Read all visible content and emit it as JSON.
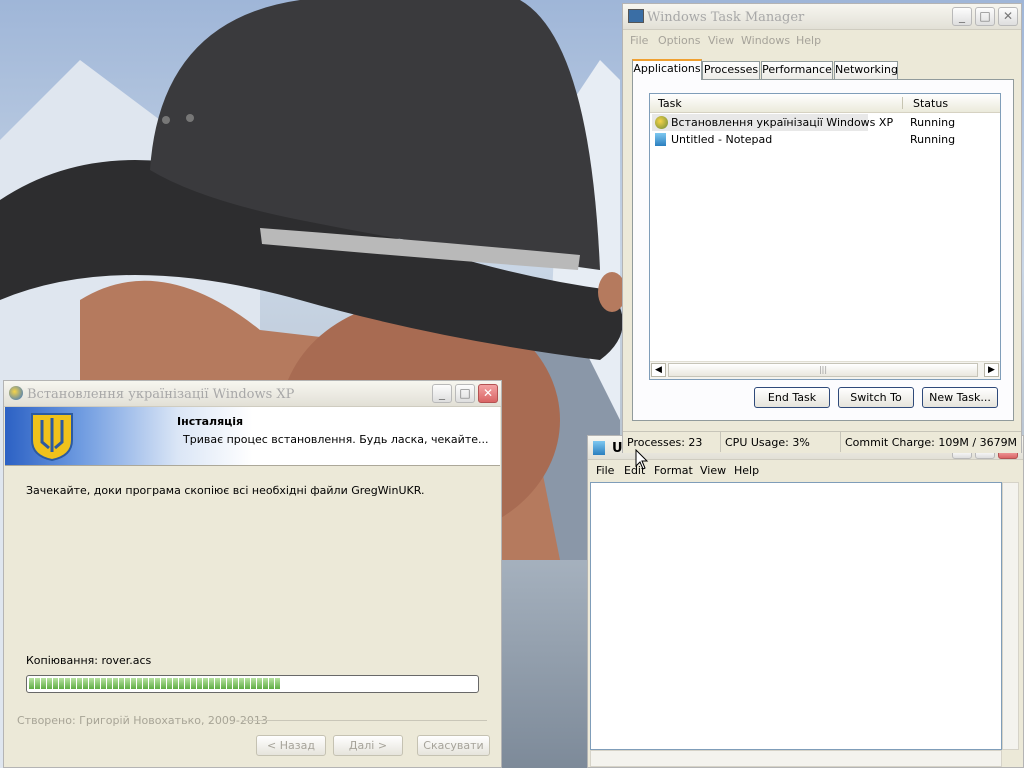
{
  "installer": {
    "title": "Встановлення українізації Windows XP",
    "header_title": "Інсталяція",
    "header_subtitle": "Триває процес встановлення. Будь ласка, чекайте...",
    "message": "Зачекайте, доки програма скопіює всі необхідні файли GregWinUKR.",
    "copy_status": "Копіювання: rover.acs",
    "progress_fraction": 0.57,
    "credits": "Створено: Григорій Новохатько, 2009-2013",
    "back_label": "< Назад",
    "next_label": "Далі >",
    "cancel_label": "Скасувати"
  },
  "task_manager": {
    "title": "Windows Task Manager",
    "menu": [
      "File",
      "Options",
      "View",
      "Windows",
      "Help"
    ],
    "tabs": [
      "Applications",
      "Processes",
      "Performance",
      "Networking"
    ],
    "columns": [
      "Task",
      "Status"
    ],
    "rows": [
      {
        "task": "Встановлення українізації Windows XP",
        "status": "Running"
      },
      {
        "task": "Untitled - Notepad",
        "status": "Running"
      }
    ],
    "end_task_label": "End Task",
    "switch_to_label": "Switch To",
    "new_task_label": "New Task...",
    "status": {
      "processes": "Processes: 23",
      "cpu": "CPU Usage: 3%",
      "commit": "Commit Charge: 109M / 3679M"
    }
  },
  "notepad": {
    "title_partial": "U",
    "menu": [
      "File",
      "Edit",
      "Format",
      "View",
      "Help"
    ]
  },
  "colors": {
    "accent_tab": "#f0a030",
    "progress_green": "#5fae44",
    "selection": "#e8e8e8"
  }
}
